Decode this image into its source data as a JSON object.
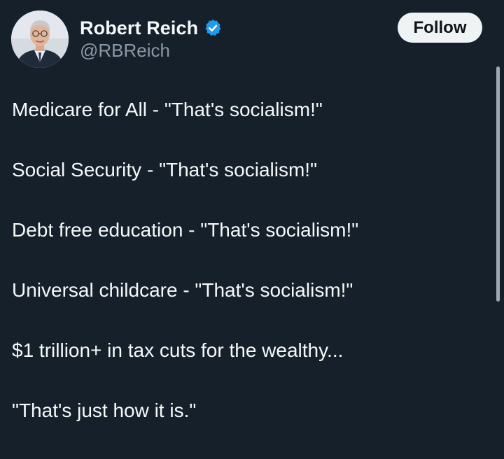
{
  "author": {
    "display_name": "Robert Reich",
    "handle": "@RBReich",
    "verified": true,
    "avatar_icon": "profile-photo"
  },
  "follow_button": {
    "label": "Follow"
  },
  "tweet": {
    "lines": [
      "Medicare for All - \"That's socialism!\"",
      "Social Security - \"That's socialism!\"",
      "Debt free education - \"That's socialism!\"",
      "Universal childcare - \"That's socialism!\"",
      "$1 trillion+ in tax cuts for the wealthy...",
      "\"That's just how it is.\""
    ]
  },
  "colors": {
    "background": "#15202b",
    "text_primary": "#f7f9f9",
    "text_secondary": "#8b98a5",
    "verified_badge": "#1d9bf0",
    "follow_button_bg": "#eff3f4"
  }
}
